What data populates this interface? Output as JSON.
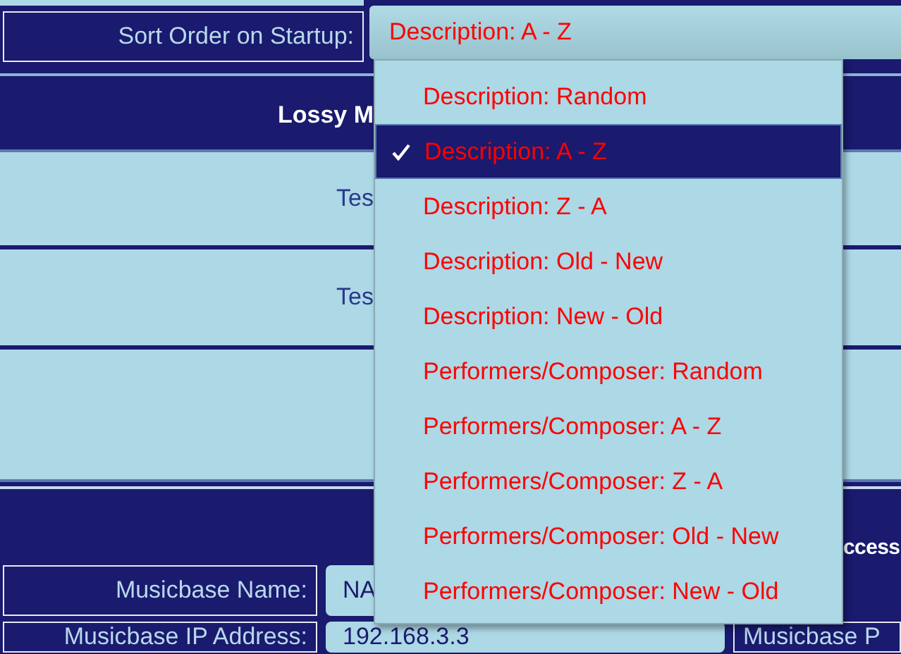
{
  "sort_setting": {
    "label": "Sort Order on Startup:",
    "value": "Description: A - Z",
    "expanded": true
  },
  "lossy_section": {
    "title": "Lossy M",
    "rows": [
      {
        "label": "Tes"
      },
      {
        "label": "Tes"
      }
    ]
  },
  "access_section": {
    "title": "ccess",
    "fields": [
      {
        "label": "Musicbase Name:",
        "value": "NA"
      },
      {
        "label": "Musicbase IP Address:",
        "value": "192.168.3.3",
        "side_label": "Musicbase P"
      }
    ]
  },
  "dropdown": {
    "options": [
      {
        "label": "Description: Random",
        "selected": false
      },
      {
        "label": "Description: A - Z",
        "selected": true
      },
      {
        "label": "Description: Z - A",
        "selected": false
      },
      {
        "label": "Description: Old - New",
        "selected": false
      },
      {
        "label": "Description: New - Old",
        "selected": false
      },
      {
        "label": "Performers/Composer: Random",
        "selected": false
      },
      {
        "label": "Performers/Composer: A - Z",
        "selected": false
      },
      {
        "label": "Performers/Composer: Z - A",
        "selected": false
      },
      {
        "label": "Performers/Composer: Old - New",
        "selected": false
      },
      {
        "label": "Performers/Composer: New - Old",
        "selected": false
      }
    ]
  }
}
